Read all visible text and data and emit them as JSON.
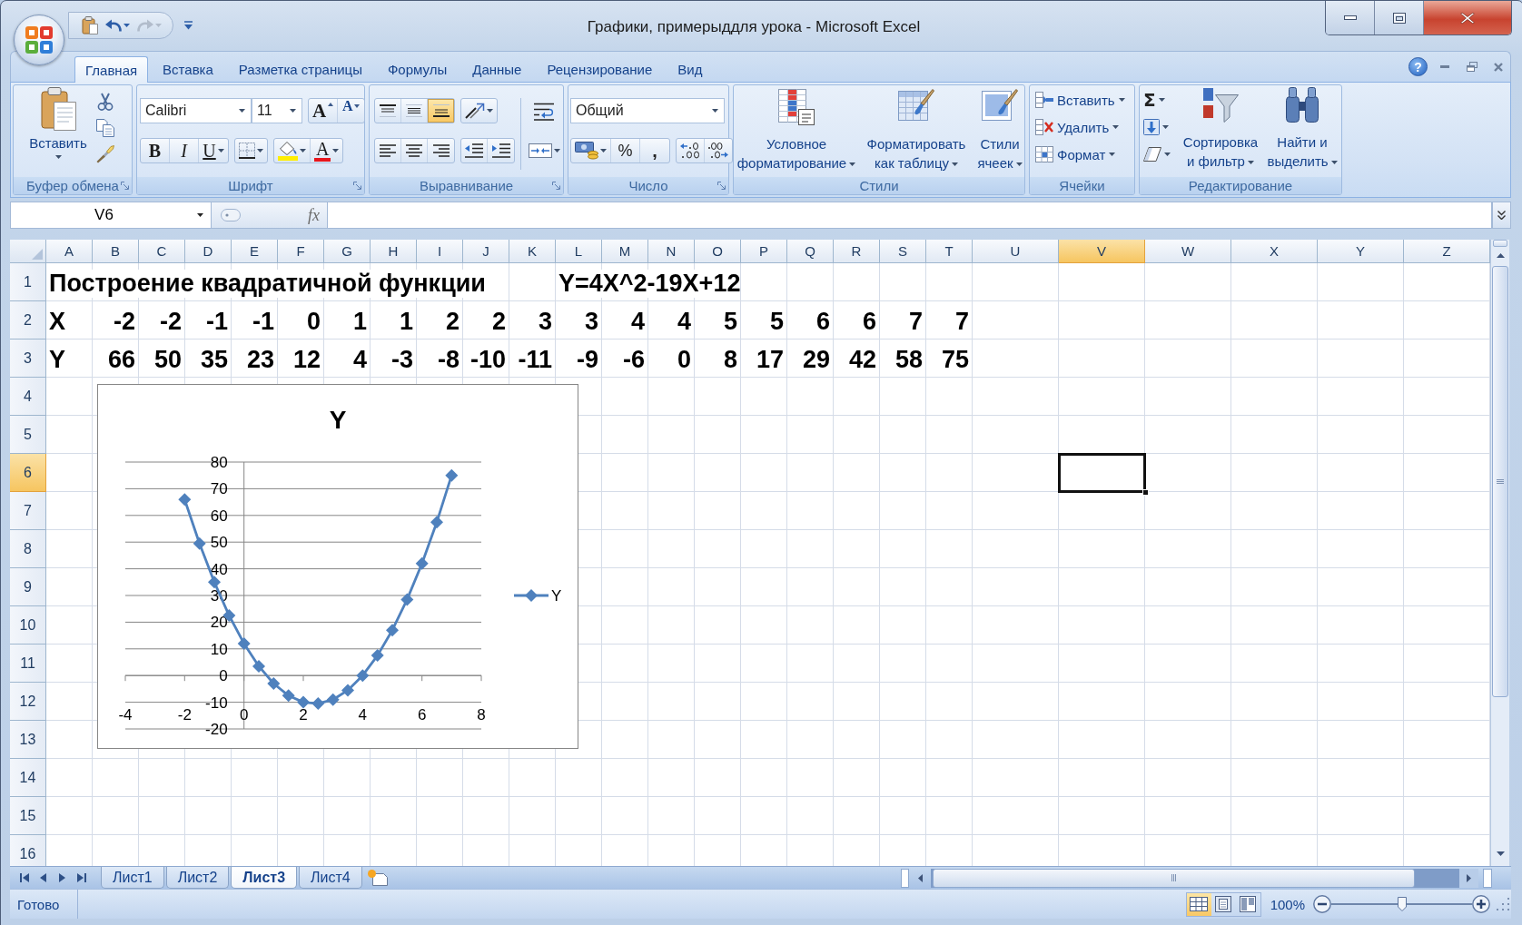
{
  "window": {
    "title": "Графики, примерыддля урока - Microsoft Excel"
  },
  "quick_access": [
    {
      "kind": "paste",
      "disabled": false
    },
    {
      "kind": "undo",
      "disabled": false
    },
    {
      "kind": "redo",
      "disabled": true
    }
  ],
  "ribbon": {
    "tabs": [
      {
        "label": "Главная",
        "selected": true
      },
      {
        "label": "Вставка",
        "selected": false
      },
      {
        "label": "Разметка страницы",
        "selected": false
      },
      {
        "label": "Формулы",
        "selected": false
      },
      {
        "label": "Данные",
        "selected": false
      },
      {
        "label": "Рецензирование",
        "selected": false
      },
      {
        "label": "Вид",
        "selected": false
      }
    ],
    "help_label": "?",
    "groups": [
      {
        "kind": "clipboard",
        "title": "Буфер обмена",
        "launcher": true,
        "paste_label": "Вставить"
      },
      {
        "kind": "font",
        "title": "Шрифт",
        "launcher": true,
        "font_name": "Calibri",
        "font_size": "11",
        "size_buttons": [
          {
            "kind": "grow",
            "label": "A"
          },
          {
            "kind": "shrink",
            "label": "A"
          }
        ],
        "style_buttons": [
          {
            "kind": "bold",
            "label": "B"
          },
          {
            "kind": "italic",
            "label": "I"
          },
          {
            "kind": "underline",
            "label": "U"
          }
        ],
        "font_color_label": "A"
      },
      {
        "kind": "alignment",
        "title": "Выравнивание",
        "launcher": true,
        "vertical": [
          {
            "kind": "top",
            "selected": false
          },
          {
            "kind": "middle",
            "selected": false
          },
          {
            "kind": "bottom",
            "selected": true
          }
        ],
        "horizontal": [
          {
            "kind": "left",
            "selected": false
          },
          {
            "kind": "center",
            "selected": false
          },
          {
            "kind": "right",
            "selected": false
          }
        ]
      },
      {
        "kind": "number",
        "title": "Число",
        "launcher": true,
        "format": "Общий",
        "percent_label": "%",
        "comma_label": ","
      },
      {
        "kind": "styles",
        "title": "Стили",
        "launcher": false,
        "buttons": [
          {
            "kind": "conditional",
            "lines": [
              "Условное",
              "форматирование"
            ]
          },
          {
            "kind": "table",
            "lines": [
              "Форматировать",
              "как таблицу"
            ]
          },
          {
            "kind": "cell",
            "lines": [
              "Стили",
              "ячеек"
            ]
          }
        ]
      },
      {
        "kind": "cells",
        "title": "Ячейки",
        "launcher": false,
        "buttons": [
          {
            "kind": "insert",
            "label": "Вставить"
          },
          {
            "kind": "delete",
            "label": "Удалить"
          },
          {
            "kind": "format",
            "label": "Формат"
          }
        ]
      },
      {
        "kind": "editing",
        "title": "Редактирование",
        "launcher": false,
        "sum_label": "Σ",
        "buttons": [
          {
            "kind": "sort",
            "lines": [
              "Сортировка",
              "и фильтр"
            ]
          },
          {
            "kind": "find",
            "lines": [
              "Найти и",
              "выделить"
            ]
          }
        ]
      }
    ]
  },
  "formula_bar": {
    "name_box": "V6",
    "function_label": "fx"
  },
  "sheet": {
    "columns": [
      {
        "label": "A",
        "selected": false
      },
      {
        "label": "B",
        "selected": false
      },
      {
        "label": "C",
        "selected": false
      },
      {
        "label": "D",
        "selected": false
      },
      {
        "label": "E",
        "selected": false
      },
      {
        "label": "F",
        "selected": false
      },
      {
        "label": "G",
        "selected": false
      },
      {
        "label": "H",
        "selected": false
      },
      {
        "label": "I",
        "selected": false
      },
      {
        "label": "J",
        "selected": false
      },
      {
        "label": "K",
        "selected": false
      },
      {
        "label": "L",
        "selected": false
      },
      {
        "label": "M",
        "selected": false
      },
      {
        "label": "N",
        "selected": false
      },
      {
        "label": "O",
        "selected": false
      },
      {
        "label": "P",
        "selected": false
      },
      {
        "label": "Q",
        "selected": false
      },
      {
        "label": "R",
        "selected": false
      },
      {
        "label": "S",
        "selected": false
      },
      {
        "label": "T",
        "selected": false
      },
      {
        "label": "U",
        "selected": false
      },
      {
        "label": "V",
        "selected": true
      },
      {
        "label": "W",
        "selected": false
      },
      {
        "label": "X",
        "selected": false
      },
      {
        "label": "Y",
        "selected": false
      },
      {
        "label": "Z",
        "selected": false
      }
    ],
    "rows": [
      {
        "header": "1",
        "selected": false,
        "kind": "heading",
        "cells": [
          "Построение квадратичной функции",
          null,
          null,
          null,
          null,
          null,
          null,
          null,
          null,
          null,
          null,
          "Y=4X^2-19X+12"
        ]
      },
      {
        "header": "2",
        "selected": false,
        "kind": "values",
        "cells": [
          "X",
          "-2",
          "-2",
          "-1",
          "-1",
          "0",
          "1",
          "1",
          "2",
          "2",
          "3",
          "3",
          "4",
          "4",
          "5",
          "5",
          "6",
          "6",
          "7",
          "7"
        ]
      },
      {
        "header": "3",
        "selected": false,
        "kind": "values",
        "cells": [
          "Y",
          "66",
          "50",
          "35",
          "23",
          "12",
          "4",
          "-3",
          "-8",
          "-10",
          "-11",
          "-9",
          "-6",
          "0",
          "8",
          "17",
          "29",
          "42",
          "58",
          "75"
        ]
      },
      {
        "header": "4",
        "selected": false
      },
      {
        "header": "5",
        "selected": false
      },
      {
        "header": "6",
        "selected": true
      },
      {
        "header": "7",
        "selected": false
      },
      {
        "header": "8",
        "selected": false
      },
      {
        "header": "9",
        "selected": false
      },
      {
        "header": "10",
        "selected": false
      },
      {
        "header": "11",
        "selected": false
      },
      {
        "header": "12",
        "selected": false
      },
      {
        "header": "13",
        "selected": false
      },
      {
        "header": "14",
        "selected": false
      },
      {
        "header": "15",
        "selected": false
      },
      {
        "header": "16",
        "selected": false
      }
    ],
    "chart": {
      "chart_data": {
        "type": "line",
        "title": "Y",
        "x": [
          -2,
          -1.5,
          -1,
          -0.5,
          0,
          0.5,
          1,
          1.5,
          2,
          2.5,
          3,
          3.5,
          4,
          4.5,
          5,
          5.5,
          6,
          6.5,
          7
        ],
        "series": [
          {
            "name": "Y",
            "color": "#4f81bd",
            "marker": "diamond",
            "values": [
              66,
              49.5,
              35,
              22.5,
              12,
              3.5,
              -3,
              -7.5,
              -10,
              -10.5,
              -9,
              -5.5,
              0,
              7.5,
              17,
              28.5,
              42,
              57.5,
              75
            ]
          }
        ],
        "xlim": [
          -4,
          8
        ],
        "ylim": [
          -20,
          80
        ],
        "xticks": [
          -4,
          -2,
          0,
          2,
          4,
          6,
          8
        ],
        "yticks": [
          -20,
          -10,
          0,
          10,
          20,
          30,
          40,
          50,
          60,
          70,
          80
        ],
        "grid": true
      }
    }
  },
  "sheet_tabs": [
    {
      "label": "Лист1",
      "selected": false
    },
    {
      "label": "Лист2",
      "selected": false
    },
    {
      "label": "Лист3",
      "selected": true
    },
    {
      "label": "Лист4",
      "selected": false
    }
  ],
  "status_bar": {
    "status": "Готово",
    "views": [
      {
        "kind": "normal",
        "selected": true
      },
      {
        "kind": "page_layout",
        "selected": false
      },
      {
        "kind": "page_break",
        "selected": false
      }
    ],
    "zoom": {
      "reading": "100%",
      "level": 0.5
    }
  }
}
